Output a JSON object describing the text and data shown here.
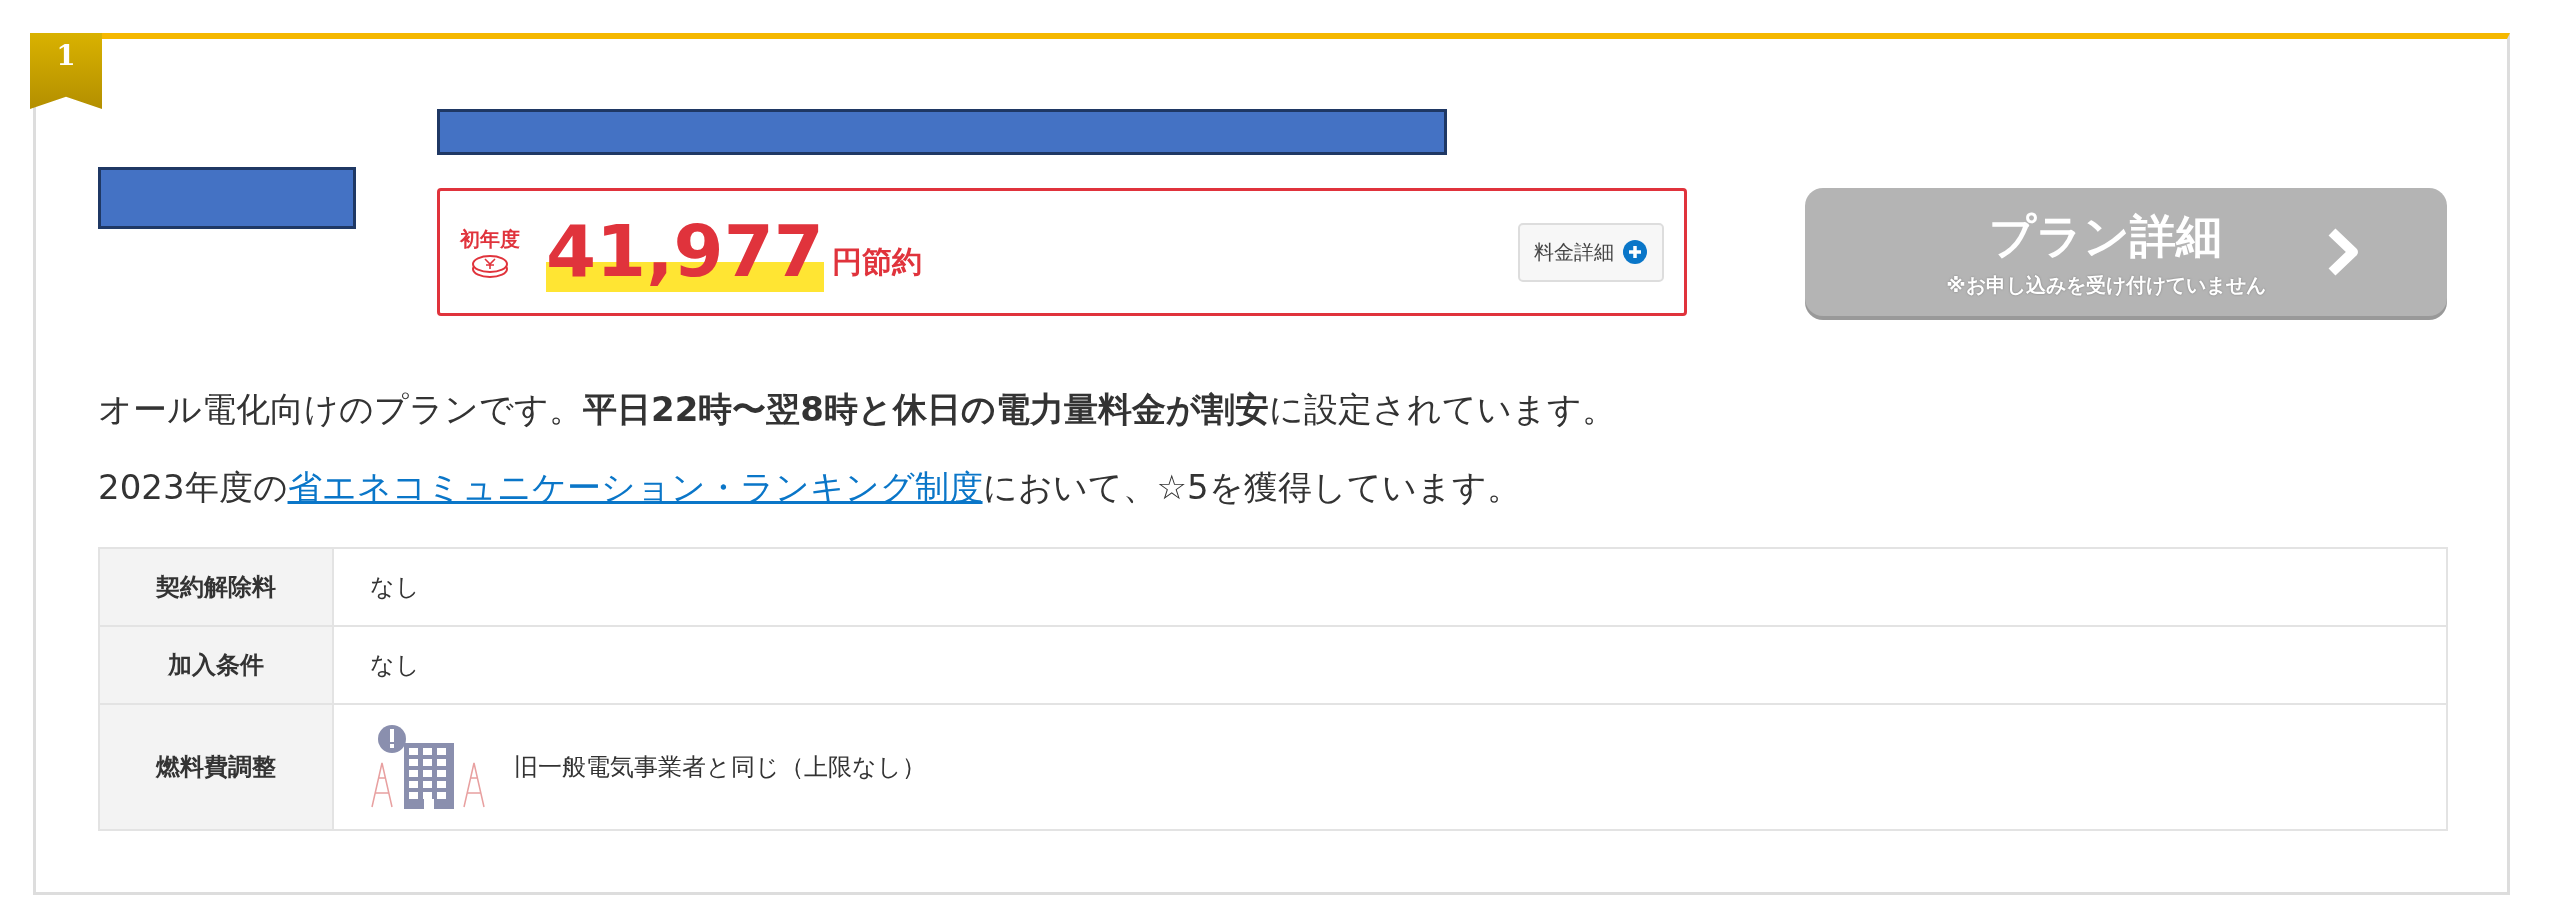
{
  "rank": "1",
  "savings": {
    "label": "初年度",
    "amount": "41,977",
    "unit": "円節約",
    "detail_button": "料金詳細"
  },
  "plan_button": {
    "title": "プラン詳細",
    "note": "※お申し込みを受け付けていません",
    "disabled": true
  },
  "description": {
    "line1": "オール電化向けのプランです。**平日22時〜翌8時と休日の電力量料金が割安**に設定されています。",
    "line2_before": "2023年度の",
    "line2_link": "省エネコミュニケーション・ランキング制度",
    "line2_after": "において、☆5を獲得しています。"
  },
  "table": {
    "rows": [
      {
        "label": "契約解除料",
        "value": "なし",
        "kind": "text"
      },
      {
        "label": "加入条件",
        "value": "なし",
        "kind": "text"
      },
      {
        "label": "燃料費調整",
        "value": "旧一般電気事業者と同じ（上限なし）",
        "kind": "icon"
      }
    ]
  }
}
